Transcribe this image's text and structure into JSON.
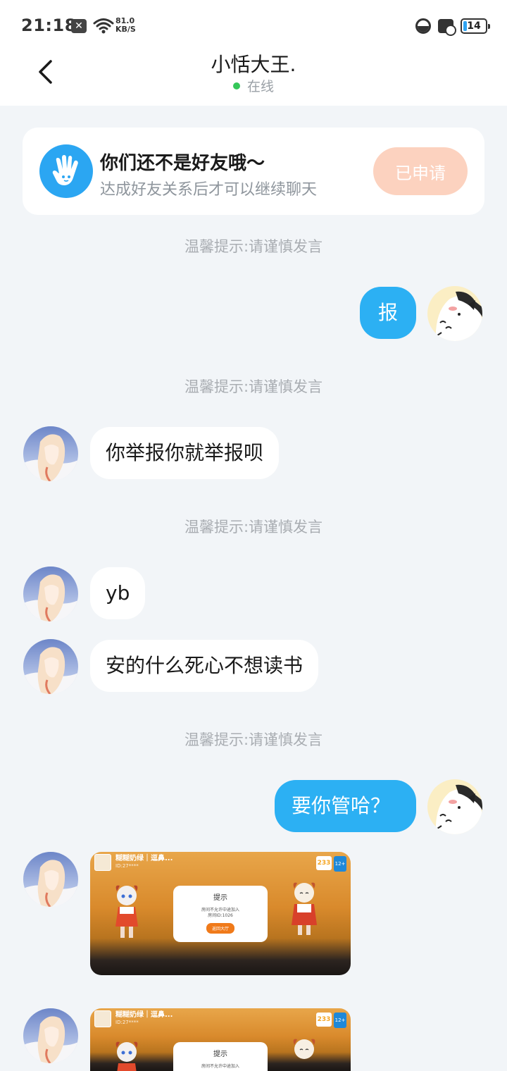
{
  "status_bar": {
    "time": "21:18",
    "notif_x": "✕",
    "speed_value": "81.0",
    "speed_unit": "KB/S",
    "battery": "14"
  },
  "header": {
    "title": "小恬大王.",
    "status": "在线",
    "status_color": "#35c759"
  },
  "friend_notice": {
    "title": "你们还不是好友哦～",
    "subtitle": "达成好友关系后才可以继续聊天",
    "button_label": "已申请",
    "button_color": "#fcd2bf",
    "icon": "hand-wave-icon"
  },
  "chat": {
    "tip_text": "温馨提示:请谨慎发言",
    "messages": [
      {
        "side": "right",
        "text": "报"
      },
      {
        "side": "left",
        "text": "你举报你就举报呗"
      },
      {
        "side": "left",
        "text": "yb"
      },
      {
        "side": "left",
        "text": "安的什么死心不想读书"
      },
      {
        "side": "right",
        "text": "要你管哈？"
      },
      {
        "side": "left",
        "type": "image"
      },
      {
        "side": "left",
        "type": "image"
      }
    ],
    "image_message": {
      "game_title": "糊糊奶绿｜逗鼻...",
      "game_subtitle": "ID:27****",
      "badge_233": "233",
      "age_badge": "12+",
      "dialog_title": "提示",
      "dialog_text1": "房间不允许中途加入",
      "dialog_text2": "房间ID:1026",
      "dialog_button": "返回大厅"
    },
    "outgoing_bubble_color": "#2cb0f3"
  }
}
